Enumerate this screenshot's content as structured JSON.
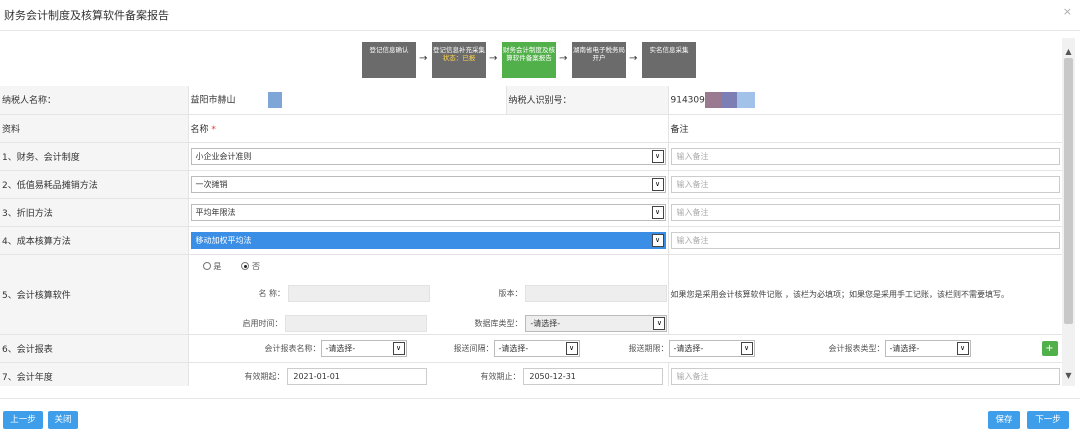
{
  "dialog": {
    "title": "财务会计制度及核算软件备案报告",
    "close": "×"
  },
  "steps": [
    {
      "label": "登记信息确认",
      "sub": ""
    },
    {
      "label": "登记信息补充采集",
      "sub": "状态：已报"
    },
    {
      "label": "财务会计制度及核算软件备案报告",
      "sub": ""
    },
    {
      "label": "湖南省电子税务局开户",
      "sub": ""
    },
    {
      "label": "实名信息采集",
      "sub": ""
    }
  ],
  "arrow": "→",
  "taxpayer": {
    "name_label": "纳税人名称：",
    "name_value": "益阳市赫山",
    "id_label": "纳税人识别号：",
    "id_value": "914309"
  },
  "header": {
    "col_material": "资料",
    "col_name": "名称",
    "col_name_required": "*",
    "col_remark": "备注"
  },
  "rows": [
    {
      "label": "1、财务、会计制度",
      "value": "小企业会计准则",
      "remark_placeholder": "输入备注"
    },
    {
      "label": "2、低值易耗品摊销方法",
      "value": "一次摊销",
      "remark_placeholder": "输入备注"
    },
    {
      "label": "3、折旧方法",
      "value": "平均年限法",
      "remark_placeholder": "输入备注"
    },
    {
      "label": "4、成本核算方法",
      "value": "移动加权平均法",
      "remark_placeholder": "输入备注"
    }
  ],
  "software": {
    "label": "5、会计核算软件",
    "radio_yes": "是",
    "radio_no": "否",
    "name_label": "名 称：",
    "version_label": "版本：",
    "start_label": "启用时间：",
    "db_label": "数据库类型：",
    "db_value": "-请选择-",
    "hint": "如果您是采用会计核算软件记账 ，该栏为必填项；如果您是采用手工记账，该栏则不需要填写。"
  },
  "report": {
    "label": "6、会计报表",
    "name_label": "会计报表名称：",
    "name_value": "-请选择-",
    "interval_label": "报送间隔：",
    "interval_value": "-请选择-",
    "period_label": "报送期限：",
    "period_value": "-请选择-",
    "type_label": "会计报表类型：",
    "type_value": "-请选择-",
    "add": "+"
  },
  "year": {
    "label": "7、会计年度",
    "start_label": "有效期起：",
    "start_value": "2021-01-01",
    "end_label": "有效期止：",
    "end_value": "2050-12-31",
    "remark_placeholder": "输入备注"
  },
  "buttons": {
    "prev": "上一步",
    "close": "关闭",
    "save": "保存",
    "next": "下一步"
  },
  "scroll": {
    "up": "▲",
    "down": "▼"
  },
  "dropdown_glyph": "∨"
}
